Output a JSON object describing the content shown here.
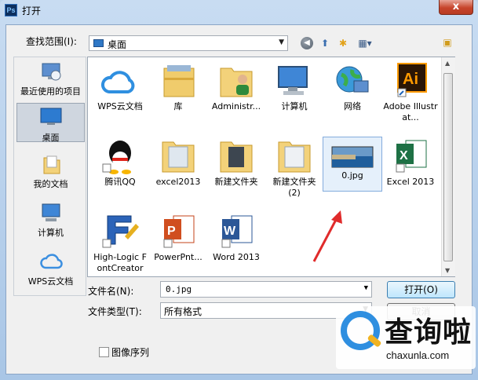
{
  "window": {
    "title": "打开",
    "app_icon_text": "Ps",
    "close_label": "x"
  },
  "lookin": {
    "label": "查找范围(I):",
    "value": "桌面"
  },
  "places": [
    {
      "label": "最近使用的项目"
    },
    {
      "label": "桌面"
    },
    {
      "label": "我的文档"
    },
    {
      "label": "计算机"
    },
    {
      "label": "WPS云文档"
    }
  ],
  "files": [
    {
      "label": "WPS云文档",
      "icon": "cloud-icon"
    },
    {
      "label": "库",
      "icon": "library-icon"
    },
    {
      "label": "Administr...",
      "icon": "user-folder-icon"
    },
    {
      "label": "计算机",
      "icon": "computer-icon"
    },
    {
      "label": "网络",
      "icon": "network-icon"
    },
    {
      "label": "Adobe Illustrat...",
      "icon": "illustrator-icon"
    },
    {
      "label": "腾讯QQ",
      "icon": "qq-icon"
    },
    {
      "label": "excel2013",
      "icon": "folder-icon"
    },
    {
      "label": "新建文件夹",
      "icon": "folder-icon"
    },
    {
      "label": "新建文件夹 (2)",
      "icon": "folder-icon"
    },
    {
      "label": "0.jpg",
      "icon": "image-file-icon"
    },
    {
      "label": "Excel 2013",
      "icon": "excel-icon"
    },
    {
      "label": "High-Logic FontCreator",
      "icon": "fontcreator-icon"
    },
    {
      "label": "PowerPnt...",
      "icon": "powerpoint-icon"
    },
    {
      "label": "Word 2013",
      "icon": "word-icon"
    }
  ],
  "filename": {
    "label": "文件名(N):",
    "value": "0.jpg"
  },
  "filetype": {
    "label": "文件类型(T):",
    "value": "所有格式"
  },
  "buttons": {
    "open": "打开(O)",
    "cancel": "取消"
  },
  "image_sequence": {
    "label": "图像序列",
    "checked": false
  },
  "watermark": {
    "text": "查询啦",
    "url": "chaxunla.com"
  },
  "colors": {
    "accent": "#3399ff",
    "arrow": "#e02b2b",
    "watermark_blue": "#2f8fe0"
  }
}
